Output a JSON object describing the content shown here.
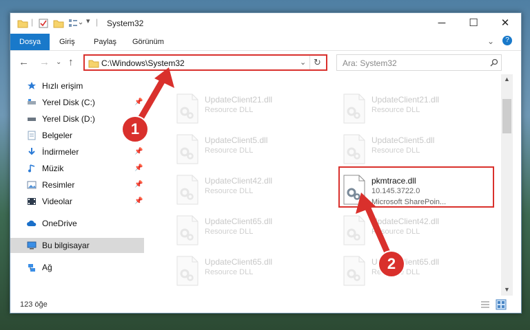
{
  "window": {
    "title": "System32"
  },
  "ribbon": {
    "tabs": [
      {
        "label": "Dosya",
        "active": true
      },
      {
        "label": "Giriş"
      },
      {
        "label": "Paylaş"
      },
      {
        "label": "Görünüm"
      }
    ]
  },
  "address": {
    "path": "C:\\Windows\\System32",
    "search_placeholder": "Ara: System32"
  },
  "sidebar": {
    "items": [
      {
        "label": "Hızlı erişim",
        "icon": "star-icon"
      },
      {
        "label": "Yerel Disk (C:)",
        "icon": "drive-icon",
        "pinned": true
      },
      {
        "label": "Yerel Disk (D:)",
        "icon": "drive-icon",
        "pinned": true
      },
      {
        "label": "Belgeler",
        "icon": "document-icon",
        "pinned": true
      },
      {
        "label": "İndirmeler",
        "icon": "download-icon",
        "pinned": true
      },
      {
        "label": "Müzik",
        "icon": "music-icon",
        "pinned": true
      },
      {
        "label": "Resimler",
        "icon": "picture-icon",
        "pinned": true
      },
      {
        "label": "Videolar",
        "icon": "video-icon",
        "pinned": true
      },
      {
        "label": "OneDrive",
        "icon": "cloud-icon"
      },
      {
        "label": "Bu bilgisayar",
        "icon": "computer-icon",
        "selected": true
      },
      {
        "label": "Ağ",
        "icon": "network-icon"
      }
    ]
  },
  "files": [
    {
      "name": "UpdateClient21.dll",
      "type": "Resource DLL"
    },
    {
      "name": "UpdateClient21.dll",
      "type": "Resource DLL"
    },
    {
      "name": "UpdateClient5.dll",
      "type": "Resource DLL"
    },
    {
      "name": "UpdateClient5.dll",
      "type": "Resource DLL"
    },
    {
      "name": "UpdateClient42.dll",
      "type": "Resource DLL"
    },
    {
      "name": "pkmtrace.dll",
      "version": "10.145.3722.0",
      "type": "Microsoft SharePoin...",
      "highlighted": true
    },
    {
      "name": "UpdateClient65.dll",
      "type": "Resource DLL"
    },
    {
      "name": "UpdateClient42.dll",
      "type": "Resource DLL"
    },
    {
      "name": "UpdateClient65.dll",
      "type": "Resource DLL"
    },
    {
      "name": "UpdateClient65.dll",
      "type": "Resource DLL"
    }
  ],
  "status": {
    "count": "123 öğe"
  },
  "badges": {
    "first": "1",
    "second": "2"
  },
  "colors": {
    "accent": "#1979ca",
    "highlight": "#d9302c"
  }
}
